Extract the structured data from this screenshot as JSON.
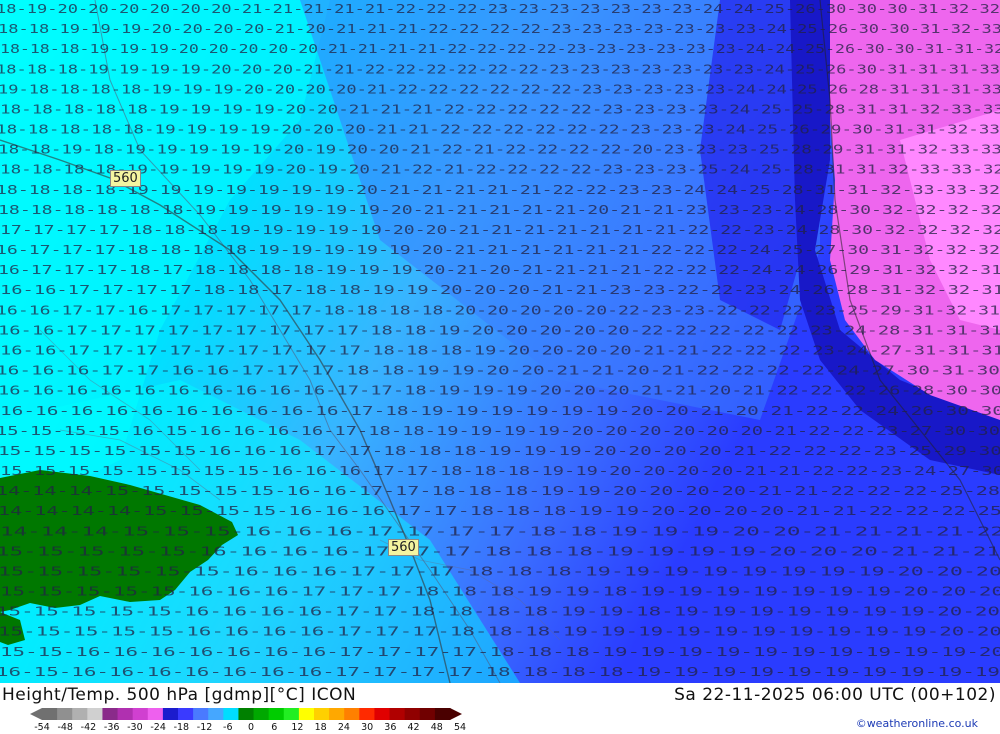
{
  "map": {
    "contour_labels": [
      "560",
      "560"
    ],
    "row_values": [
      "18 19 20 20 20 20 20 20 21 21 21 21 21 22 22 22 23 23 23 23 23 23 23 24 24 25 26 30 30 30 31 32 32",
      "18 18 19 19 19 20 20 20 20 21 20 21 21 21 22 22 22 22 23 23 23 23 23 23 23 24 25 26 30 30 31 32 33",
      "18 18 18 19 19 19 20 20 20 20 20 21 21 21 21 22 22 22 22 23 23 23 23 23 23 24 24 25 26 30 30 31 31 32",
      "18 18 18 19 19 19 19 20 20 20 21 21 22 22 22 22 22 22 23 23 23 23 23 23 23 24 25 26 30 31 31 31 33",
      "19 18 18 18 18 19 19 19 20 20 20 20 21 22 22 22 22 22 22 23 23 23 23 23 24 24 25 26 28 31 31 31 33",
      "18 18 18 18 18 19 19 19 19 20 20 21 21 21 22 22 22 22 22 23 23 23 23 24 25 25 28 31 31 32 33 33",
      "18 18 18 18 18 19 19 19 19 20 20 20 21 21 22 22 22 22 22 22 23 23 23 24 25 26 29 30 31 31 32 33",
      "18 18 19 18 19 19 19 19 19 20 19 20 20 21 22 21 22 22 22 22 20 23 23 23 25 28 29 31 31 32 33 33",
      "18 18 18 18 19 19 19 19 19 20 19 20 21 22 21 22 22 22 22 23 23 23 25 24 25 28 31 31 32 33 33 32",
      "18 18 18 18 19 19 19 19 19 19 19 20 21 21 21 21 21 22 22 23 23 24 24 25 28 31 31 32 33 33 32",
      "18 18 18 18 18 18 19 19 19 19 19 19 20 21 21 21 21 21 20 21 21 23 23 23 24 28 30 32 32 32 32",
      "17 17 17 17 18 18 18 19 19 19 19 19 20 20 21 21 21 21 21 21 21 22 22 23 24 28 30 32 32 32 32",
      "16 17 17 17 18 18 18 18 19 19 19 19 19 20 21 21 21 21 21 21 22 22 22 24 25 27 30 31 32 32 32",
      "16 17 17 17 18 17 18 18 18 18 19 19 19 20 21 20 21 21 21 21 22 22 22 24 24 26 29 31 32 32 31",
      "16 16 17 17 17 17 18 18 17 18 18 19 19 20 20 20 21 21 23 23 22 22 23 24 26 28 31 32 32 31",
      "16 16 17 17 16 17 17 17 17 17 18 18 18 18 20 20 20 20 20 22 23 23 22 22 22 23 25 29 31 32 31",
      "16 16 17 17 17 17 17 17 17 17 17 18 18 19 20 20 20 20 20 22 22 22 22 22 23 24 28 31 31 31",
      "16 16 17 17 17 17 17 17 17 17 17 18 18 18 19 20 20 20 20 21 21 22 22 22 23 24 27 31 31 31",
      "16 16 16 17 17 16 16 17 17 17 18 18 19 19 20 20 21 21 20 21 22 22 22 22 24 27 30 31 30",
      "16 16 16 16 16 16 16 16 16 16 17 17 18 19 19 19 20 20 20 21 21 20 21 22 22 22 26 28 30 30",
      "16 16 16 16 16 16 16 16 16 16 17 18 19 19 19 19 19 19 20 20 21 20 21 22 22 24 26 30 30",
      "15 15 15 15 16 15 16 16 16 16 17 18 18 19 19 19 19 20 20 20 20 20 20 21 22 22 23 27 30 30",
      "15 15 15 15 15 15 16 16 16 17 17 18 18 18 19 19 19 20 20 20 20 21 22 22 22 23 25 29 30",
      "15 15 15 15 15 15 15 15 16 16 16 17 17 18 18 18 19 19 20 20 20 20 21 21 22 22 23 24 27 30",
      "14 14 14 15 15 15 15 15 16 16 17 17 18 18 18 19 19 20 20 20 20 21 21 22 22 22 25 28",
      "14 14 14 14 15 15 15 15 16 16 16 17 17 18 18 18 19 19 20 20 20 20 21 21 22 22 22 25",
      "14 14 14 15 15 15 16 16 16 17 17 17 17 18 18 19 19 19 20 20 21 21 21 21 22",
      "15 15 15 15 15 16 16 16 16 17 17 17 18 18 18 19 19 19 19 20 20 20 21 21 21",
      "15 15 15 15 15 15 16 16 16 17 17 17 18 18 18 19 19 19 19 19 19 19 19 20 20 20",
      "15 15 15 15 15 16 16 16 17 17 17 18 18 18 19 19 18 19 19 19 19 19 19 19 20 20 20",
      "15 15 15 15 15 16 16 16 16 17 17 18 18 18 18 19 19 18 19 19 19 19 19 19 19 20 20",
      "15 15 15 15 15 16 16 16 16 17 17 17 18 18 18 19 19 19 19 19 19 19 19 19 19 20 20",
      "15 15 16 16 16 16 16 16 16 17 17 17 17 18 18 18 19 19 19 19 19 19 19 19 19 19 20",
      "16 15 16 16 16 16 16 16 16 17 17 17 17 18 18 18 18 19 19 19 19 19 19 19 19 19 19"
    ]
  },
  "footer": {
    "title": "Height/Temp. 500 hPa [gdmp][°C] ICON",
    "timestamp": "Sa 22-11-2025 06:00 UTC (00+102)",
    "credit": "©weatheronline.co.uk",
    "scale_ticks": [
      "-54",
      "-48",
      "-42",
      "-36",
      "-30",
      "-24",
      "-18",
      "-12",
      "-6",
      "0",
      "6",
      "12",
      "18",
      "24",
      "30",
      "36",
      "42",
      "48",
      "54"
    ],
    "scale_colors": [
      "#707070",
      "#909090",
      "#b0b0b0",
      "#d0d0d0",
      "#8a2b8a",
      "#b030b0",
      "#d040d0",
      "#ee60ee",
      "#1c1ccd",
      "#3a3aff",
      "#4a7aff",
      "#45a7ff",
      "#00ddff",
      "#008000",
      "#00a800",
      "#00cc00",
      "#22ee22",
      "#ffff00",
      "#ffd000",
      "#ffa800",
      "#ff8000",
      "#ff2a00",
      "#e00000",
      "#b00000",
      "#900000",
      "#700000",
      "#4a0000"
    ]
  }
}
